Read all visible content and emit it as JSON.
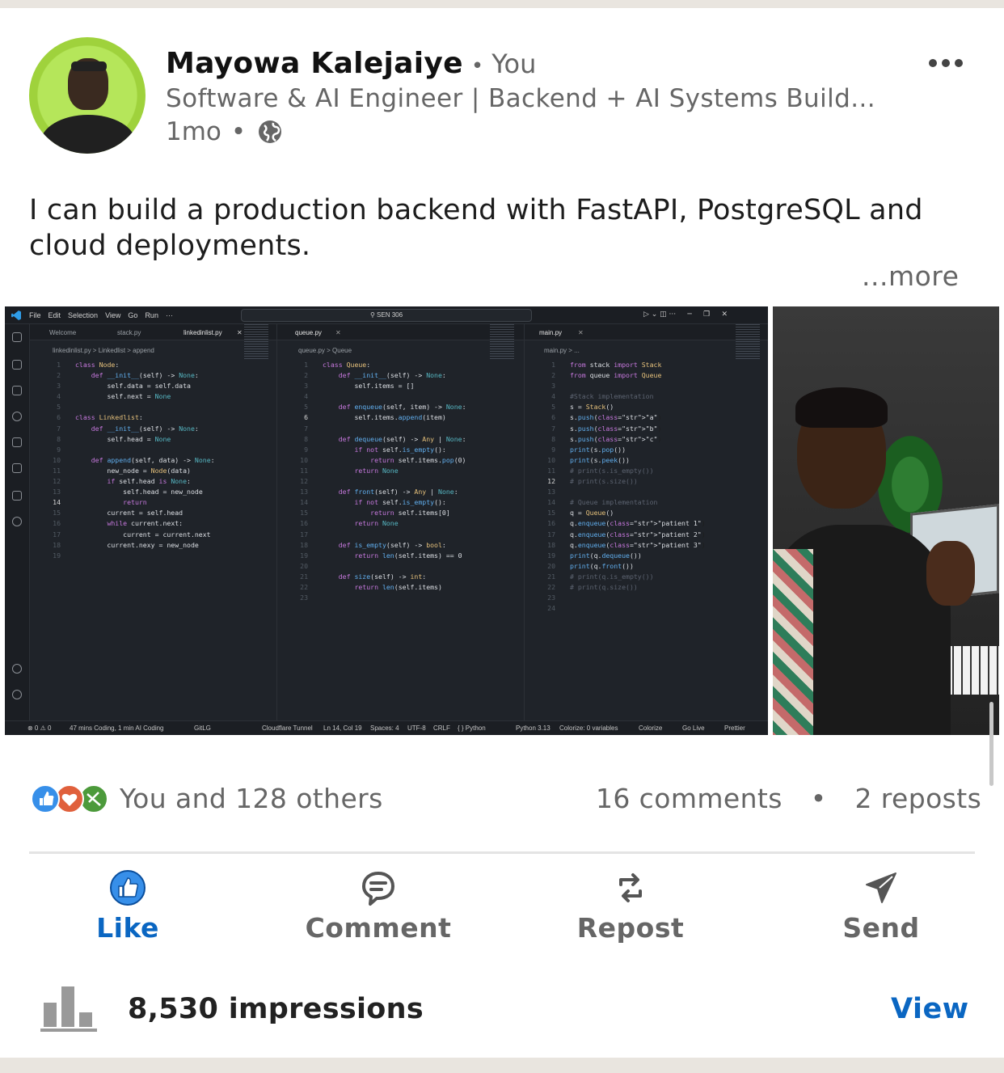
{
  "post": {
    "author": "Mayowa Kalejaiye",
    "relation": "You",
    "headline": "Software & AI Engineer | Backend + AI Systems Build...",
    "time": "1mo",
    "text": "I can build a production backend with FastAPI, PostgreSQL and cloud deployments.",
    "see_more": "...more"
  },
  "ide": {
    "menu": [
      "File",
      "Edit",
      "Selection",
      "View",
      "Go",
      "Run",
      "···"
    ],
    "search": "SEN 306",
    "pane1": {
      "tabs": [
        "Welcome",
        "stack.py",
        "linkedinlist.py"
      ],
      "breadcrumb": "linkedinlist.py > Linkedlist > append",
      "lines": [
        "class Node:",
        "    def __init__(self) -> None:",
        "        self.data = self.data",
        "        self.next = None",
        "",
        "class Linkedlist:",
        "    def __init__(self) -> None:",
        "        self.head = None",
        "",
        "    def append(self, data) -> None:",
        "        new_node = Node(data)",
        "        if self.head is None:",
        "            self.head = new_node",
        "            return",
        "        current = self.head",
        "        while current.next:",
        "            current = current.next",
        "        current.nexy = new_node",
        ""
      ]
    },
    "pane2": {
      "tabs": [
        "queue.py"
      ],
      "breadcrumb": "queue.py > Queue",
      "lines": [
        "class Queue:",
        "    def __init__(self) -> None:",
        "        self.items = []",
        "",
        "    def enqueue(self, item) -> None:",
        "        self.items.append(item)",
        "",
        "    def dequeue(self) -> Any | None:",
        "        if not self.is_empty():",
        "            return self.items.pop(0)",
        "        return None",
        "",
        "    def front(self) -> Any | None:",
        "        if not self.is_empty():",
        "            return self.items[0]",
        "        return None",
        "",
        "    def is_empty(self) -> bool:",
        "        return len(self.items) == 0",
        "",
        "    def size(self) -> int:",
        "        return len(self.items)",
        ""
      ]
    },
    "pane3": {
      "tabs": [
        "main.py"
      ],
      "breadcrumb": "main.py > ...",
      "lines": [
        "from stack import Stack",
        "from queue import Queue",
        "",
        "#Stack implementation",
        "s = Stack()",
        "s.push(\"a\")",
        "s.push(\"b\")",
        "s.push(\"c\")",
        "print(s.pop())",
        "print(s.peek())",
        "# print(s.is_empty())",
        "# print(s.size())",
        "",
        "# Queue implementation",
        "q = Queue()",
        "q.enqueue(\"patient 1\")",
        "q.enqueue(\"patient 2\")",
        "q.enqueue(\"patient 3\")",
        "print(q.dequeue())",
        "print(q.front())",
        "# print(q.is_empty())",
        "# print(q.size())",
        "",
        ""
      ]
    },
    "status": {
      "problems": "⊗ 0 ⚠ 0",
      "coding": "47 mins Coding, 1 min AI Coding",
      "gitlg": "GitLG",
      "tunnel": "Cloudflare Tunnel",
      "position": "Ln 14, Col 19",
      "spaces": "Spaces: 4",
      "encoding": "UTF-8",
      "eol": "CRLF",
      "lang": "{ } Python",
      "python": "Python 3.13",
      "colorize": "Colorize: 0 variables",
      "colorize2": "Colorize",
      "golive": "Go Live",
      "prettier": "Prettier"
    }
  },
  "social": {
    "reactions_text": "You and 128 others",
    "comments": "16 comments",
    "reposts": "2 reposts",
    "separator": "•",
    "actions": {
      "like": "Like",
      "comment": "Comment",
      "repost": "Repost",
      "send": "Send"
    },
    "impressions": "8,530 impressions",
    "view": "View"
  },
  "colors": {
    "linkedin_blue": "#0a66c2",
    "muted_text": "#666666",
    "ide_bg": "#1f2329"
  },
  "icons": [
    "globe-icon",
    "more-options-icon",
    "like-icon",
    "comment-icon",
    "repost-icon",
    "send-icon",
    "impressions-bar-chart-icon"
  ]
}
